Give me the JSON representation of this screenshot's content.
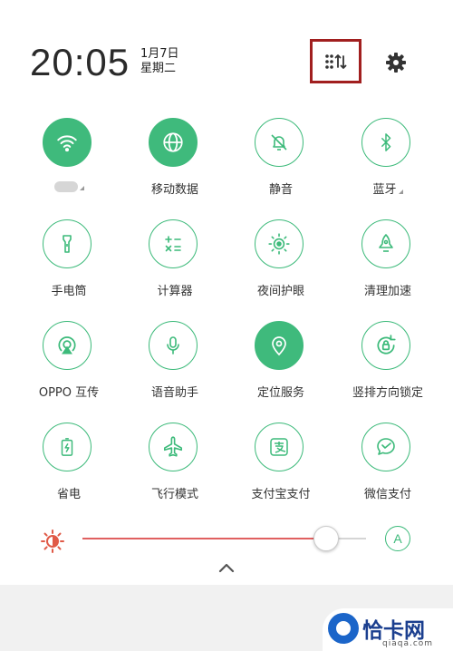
{
  "status": {
    "time": "20:05",
    "date": "1月7日",
    "weekday": "星期二"
  },
  "header": {
    "edit_icon": "grid-sort-icon",
    "settings_icon": "gear-icon"
  },
  "accent_color": "#3fba7c",
  "highlight_color": "#a11f1f",
  "tiles": [
    {
      "label": "",
      "icon": "wifi-icon",
      "active": true
    },
    {
      "label": "移动数据",
      "icon": "globe-icon",
      "active": true
    },
    {
      "label": "静音",
      "icon": "bell-mute-icon",
      "active": false
    },
    {
      "label": "蓝牙",
      "icon": "bluetooth-icon",
      "active": false
    },
    {
      "label": "手电筒",
      "icon": "flashlight-icon",
      "active": false
    },
    {
      "label": "计算器",
      "icon": "calculator-icon",
      "active": false
    },
    {
      "label": "夜间护眼",
      "icon": "eye-protection-icon",
      "active": false
    },
    {
      "label": "清理加速",
      "icon": "rocket-icon",
      "active": false
    },
    {
      "label": "OPPO 互传",
      "icon": "share-icon",
      "active": false
    },
    {
      "label": "语音助手",
      "icon": "microphone-icon",
      "active": false
    },
    {
      "label": "定位服务",
      "icon": "location-icon",
      "active": true
    },
    {
      "label": "竖排方向锁定",
      "icon": "rotation-lock-icon",
      "active": false
    },
    {
      "label": "省电",
      "icon": "battery-icon",
      "active": false
    },
    {
      "label": "飞行模式",
      "icon": "airplane-icon",
      "active": false
    },
    {
      "label": "支付宝支付",
      "icon": "alipay-icon",
      "active": false
    },
    {
      "label": "微信支付",
      "icon": "wechat-pay-icon",
      "active": false
    }
  ],
  "brightness": {
    "level": 0.87,
    "auto_label": "A"
  },
  "watermark": {
    "title": "恰卡网",
    "url": "qiaqa.com"
  }
}
